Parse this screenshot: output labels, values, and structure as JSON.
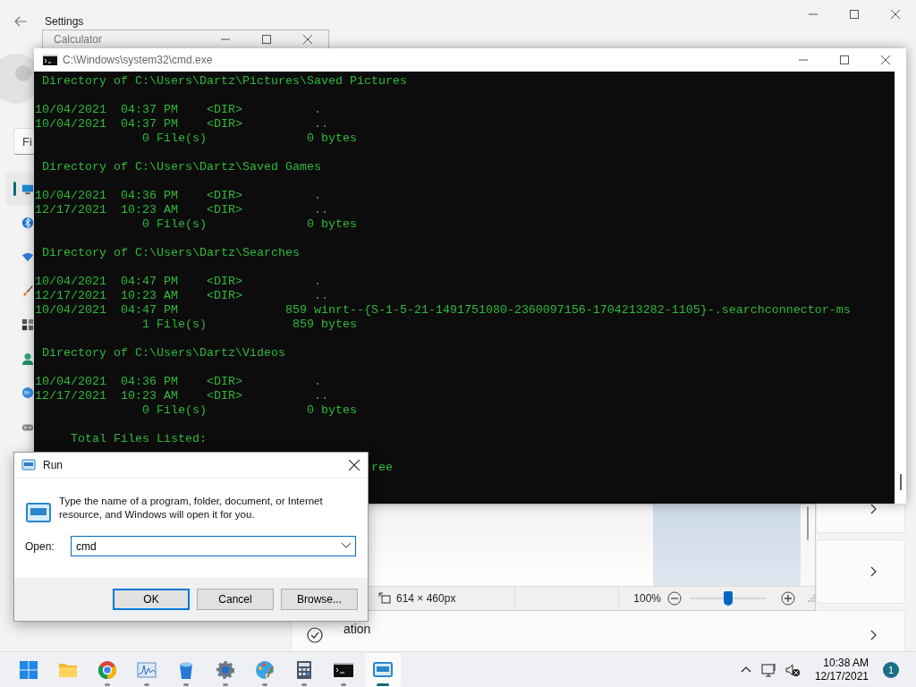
{
  "settings": {
    "title": "Settings",
    "search": {
      "placeholder": "Fi"
    },
    "nav": [
      {
        "kind": "system",
        "selected": true
      },
      {
        "kind": "bluetooth",
        "selected": false
      },
      {
        "kind": "network",
        "selected": false
      },
      {
        "kind": "personalization",
        "selected": false
      },
      {
        "kind": "apps",
        "selected": false
      },
      {
        "kind": "accounts",
        "selected": false
      },
      {
        "kind": "time",
        "selected": false
      },
      {
        "kind": "gaming",
        "selected": false
      }
    ],
    "cards": [
      {
        "kind": "plain"
      },
      {
        "kind": "plain"
      },
      {
        "kind": "setting",
        "title": "ation"
      }
    ]
  },
  "calculator": {
    "title": "Calculator"
  },
  "viewer": {
    "dimensions": "614 × 460px",
    "zoom": "100%",
    "zoom_slider": {
      "level": 0.5
    }
  },
  "cmd": {
    "title": "C:\\Windows\\system32\\cmd.exe",
    "blocks": [
      {
        "lines": [
          " Directory of C:\\Users\\Dartz\\Pictures\\Saved Pictures"
        ]
      },
      {
        "lines": [
          "10/04/2021  04:37 PM    <DIR>          .",
          "10/04/2021  04:37 PM    <DIR>          ..",
          "               0 File(s)              0 bytes"
        ]
      },
      {
        "lines": [
          " Directory of C:\\Users\\Dartz\\Saved Games"
        ]
      },
      {
        "lines": [
          "10/04/2021  04:36 PM    <DIR>          .",
          "12/17/2021  10:23 AM    <DIR>          ..",
          "               0 File(s)              0 bytes"
        ]
      },
      {
        "lines": [
          " Directory of C:\\Users\\Dartz\\Searches"
        ]
      },
      {
        "lines": [
          "10/04/2021  04:47 PM    <DIR>          .",
          "12/17/2021  10:23 AM    <DIR>          ..",
          "10/04/2021  04:47 PM               859 winrt--{S-1-5-21-1491751080-2360097156-1704213282-1105}-.searchconnector-ms",
          "               1 File(s)            859 bytes"
        ]
      },
      {
        "lines": [
          " Directory of C:\\Users\\Dartz\\Videos"
        ]
      },
      {
        "lines": [
          "10/04/2021  04:36 PM    <DIR>          .",
          "12/17/2021  10:23 AM    <DIR>          ..",
          "               0 File(s)              0 bytes"
        ]
      },
      {
        "lines": [
          "     Total Files Listed:"
        ]
      },
      {
        "lines": [
          "                                               ree"
        ]
      }
    ]
  },
  "run": {
    "title": "Run",
    "message": "Type the name of a program, folder, document, or Internet resource, and Windows will open it for you.",
    "open_label": "Open:",
    "value": "cmd",
    "buttons": [
      {
        "label": "OK",
        "default": true
      },
      {
        "label": "Cancel",
        "default": false
      },
      {
        "label": "Browse...",
        "default": false
      }
    ]
  },
  "taskbar": {
    "apps": [
      {
        "kind": "start",
        "running": false,
        "selected": false
      },
      {
        "kind": "folder",
        "running": false,
        "selected": false
      },
      {
        "kind": "browser",
        "running": true,
        "selected": false
      },
      {
        "kind": "chart",
        "running": true,
        "selected": false
      },
      {
        "kind": "bucket",
        "running": true,
        "selected": false
      },
      {
        "kind": "gear",
        "running": true,
        "selected": false
      },
      {
        "kind": "palette",
        "running": true,
        "selected": false
      },
      {
        "kind": "calculator",
        "running": true,
        "selected": false
      },
      {
        "kind": "terminal",
        "running": true,
        "selected": false
      },
      {
        "kind": "run",
        "running": true,
        "selected": true
      }
    ],
    "time": "10:38 AM",
    "date": "12/17/2021",
    "notifications": "1"
  }
}
